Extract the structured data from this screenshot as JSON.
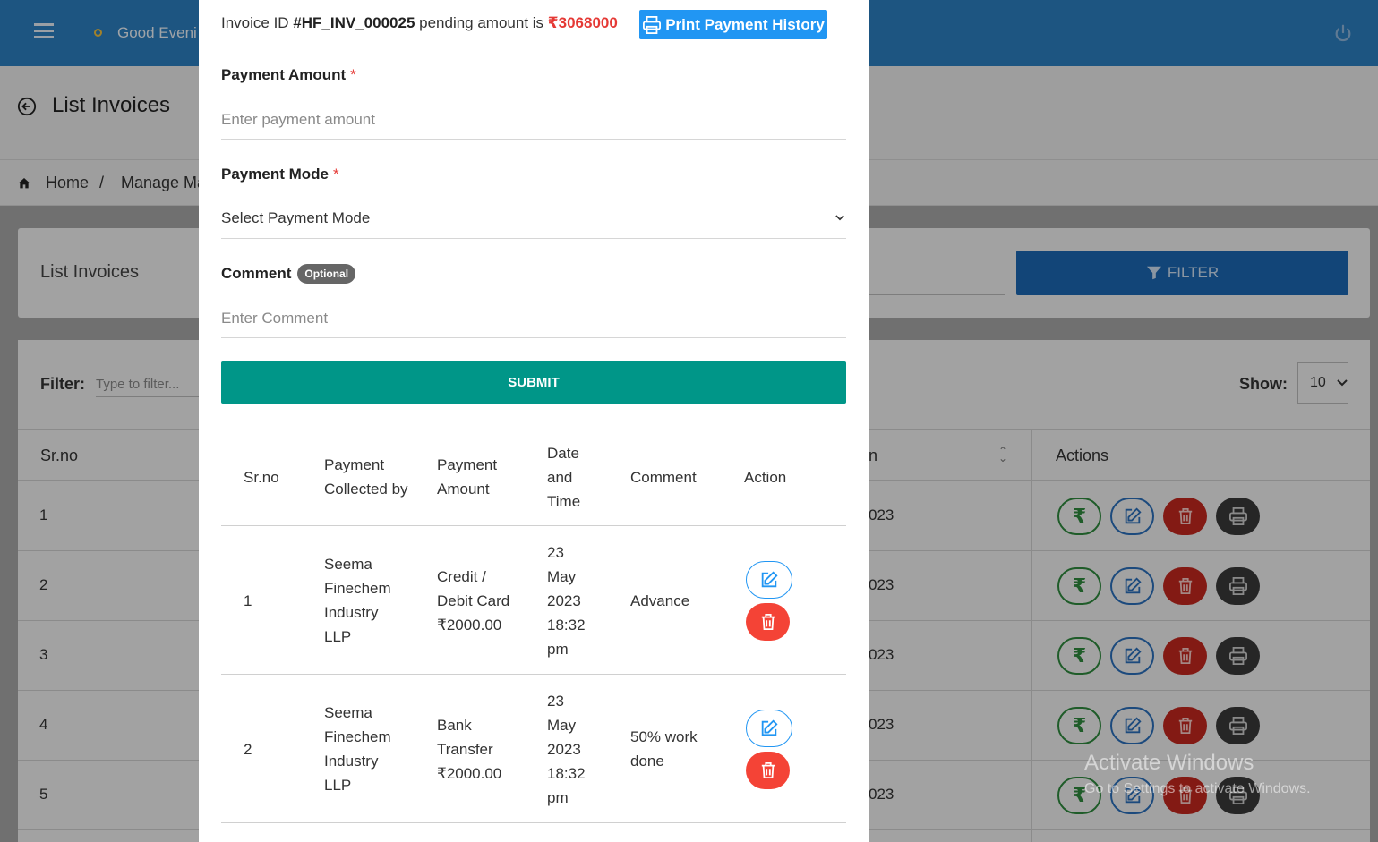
{
  "topbar": {
    "greeting": "Good Eveni"
  },
  "page": {
    "title": "List Invoices"
  },
  "breadcrumb": {
    "home": "Home",
    "separator": "/",
    "current": "Manage Ma"
  },
  "list_card": {
    "title": "List Invoices",
    "filter_button": "FILTER"
  },
  "table_controls": {
    "filter_label": "Filter:",
    "filter_placeholder": "Type to filter...",
    "show_label": "Show:",
    "show_value": "10"
  },
  "bg_table": {
    "header_srno": "Sr.no",
    "header_partial": "n",
    "header_actions": "Actions",
    "rows": [
      {
        "num": "1",
        "date_partial": "023"
      },
      {
        "num": "2",
        "date_partial": "023"
      },
      {
        "num": "3",
        "date_partial": "023"
      },
      {
        "num": "4",
        "date_partial": "023"
      },
      {
        "num": "5",
        "date_partial": "023"
      }
    ]
  },
  "modal": {
    "invoice_prefix": "Invoice ID ",
    "invoice_id": "#HF_INV_000025",
    "invoice_middle": " pending amount is ",
    "pending_amount": "₹3068000",
    "print_button": "Print Payment History",
    "payment_amount_label": "Payment Amount",
    "payment_amount_placeholder": "Enter payment amount",
    "payment_mode_label": "Payment Mode",
    "payment_mode_value": "Select Payment Mode",
    "comment_label": "Comment",
    "comment_badge": "Optional",
    "comment_placeholder": "Enter Comment",
    "required_mark": "*",
    "submit_button": "SUBMIT",
    "history": {
      "headers": {
        "srno": "Sr.no",
        "collected_by": "Payment Collected by",
        "amount": "Payment Amount",
        "datetime": "Date and Time",
        "comment": "Comment",
        "action": "Action"
      },
      "rows": [
        {
          "srno": "1",
          "collected_by": "Seema Finechem Industry LLP",
          "mode": "Credit / Debit Card",
          "amount": "₹2000.00",
          "datetime": "23 May 2023 18:32 pm",
          "comment": "Advance"
        },
        {
          "srno": "2",
          "collected_by": "Seema Finechem Industry LLP",
          "mode": "Bank Transfer",
          "amount": "₹2000.00",
          "datetime": "23 May 2023 18:32 pm",
          "comment": "50% work done"
        }
      ]
    }
  },
  "watermark": {
    "line1": "Activate Windows",
    "line2": "Go to Settings to activate Windows."
  }
}
